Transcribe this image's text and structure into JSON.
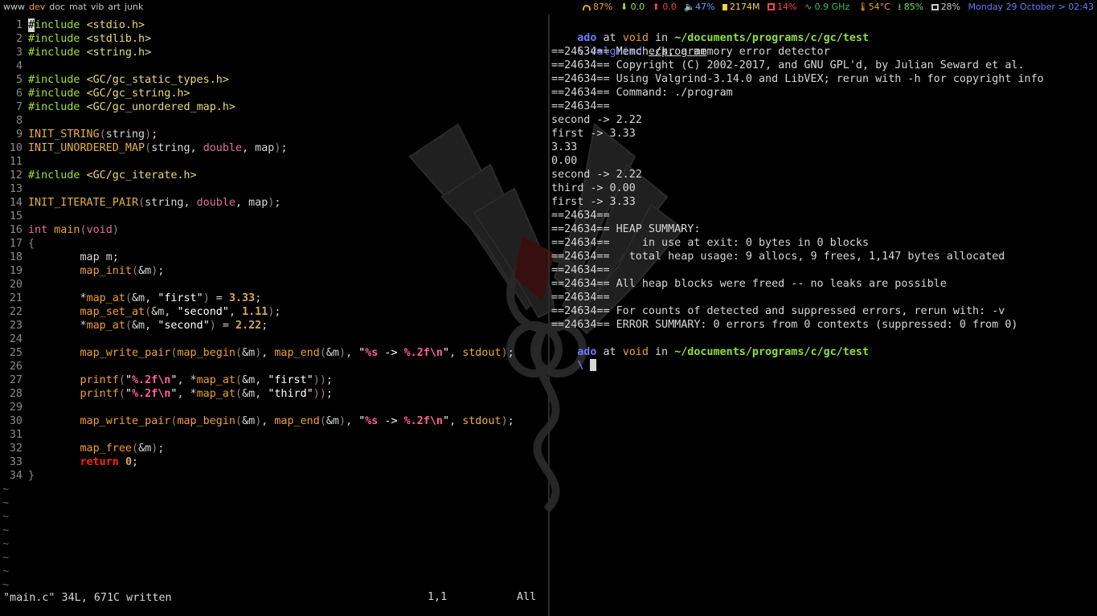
{
  "topbar": {
    "tags": [
      "www",
      "dev",
      "doc",
      "mat",
      "vib",
      "art",
      "junk"
    ],
    "active_tag": "dev",
    "wifi": "87%",
    "net_down": "0.0",
    "net_up": "0.0",
    "volume": "47%",
    "memory": "2174M",
    "cpu": "14%",
    "cpu_freq": "0.9 GHz",
    "temp": "54°C",
    "battery": "85%",
    "disk": "28%",
    "datetime": "Monday 29 October > 02:43",
    "colors": {
      "wifi": "#f0a030",
      "down": "#a6e22e",
      "up": "#ff4040",
      "vol": "#6a9bff",
      "mem": "#ffd040",
      "cpu": "#ff4060",
      "freq": "#40c060",
      "temp": "#f0a030",
      "battery": "#60e060",
      "disk": "#c8c8c8",
      "date": "#6a7bff"
    }
  },
  "editor": {
    "lines": [
      "#include <stdio.h>",
      "#include <stdlib.h>",
      "#include <string.h>",
      "",
      "#include <GC/gc_static_types.h>",
      "#include <GC/gc_string.h>",
      "#include <GC/gc_unordered_map.h>",
      "",
      "INIT_STRING(string);",
      "INIT_UNORDERED_MAP(string, double, map);",
      "",
      "#include <GC/gc_iterate.h>",
      "",
      "INIT_ITERATE_PAIR(string, double, map);",
      "",
      "int main(void)",
      "{",
      "        map m;",
      "        map_init(&m);",
      "",
      "        *map_at(&m, \"first\") = 3.33;",
      "        map_set_at(&m, \"second\", 1.11);",
      "        *map_at(&m, \"second\") = 2.22;",
      "",
      "        map_write_pair(map_begin(&m), map_end(&m), \"%s -> %.2f\\n\", stdout);",
      "",
      "        printf(\"%.2f\\n\", *map_at(&m, \"first\"));",
      "        printf(\"%.2f\\n\", *map_at(&m, \"third\"));",
      "",
      "        map_write_pair(map_begin(&m), map_end(&m), \"%s -> %.2f\\n\", stdout);",
      "",
      "        map_free(&m);",
      "        return 0;",
      "}"
    ],
    "tilde_count": 8,
    "status_message": "\"main.c\" 34L, 671C written",
    "cursor_pos": "1,1",
    "scroll": "All"
  },
  "terminal": {
    "prompt": {
      "user": "ado",
      "at": "at",
      "host": "void",
      "in": "in",
      "path": "~/documents/programs/c/gc/test",
      "arrow": "\\"
    },
    "command": "valgrind",
    "command_arg": "./program",
    "output": [
      "==24634== Memcheck, a memory error detector",
      "==24634== Copyright (C) 2002-2017, and GNU GPL'd, by Julian Seward et al.",
      "==24634== Using Valgrind-3.14.0 and LibVEX; rerun with -h for copyright info",
      "==24634== Command: ./program",
      "==24634==",
      "second -> 2.22",
      "first -> 3.33",
      "3.33",
      "0.00",
      "second -> 2.22",
      "third -> 0.00",
      "first -> 3.33",
      "==24634==",
      "==24634== HEAP SUMMARY:",
      "==24634==     in use at exit: 0 bytes in 0 blocks",
      "==24634==   total heap usage: 9 allocs, 9 frees, 1,147 bytes allocated",
      "==24634==",
      "==24634== All heap blocks were freed -- no leaks are possible",
      "==24634==",
      "==24634== For counts of detected and suppressed errors, rerun with: -v",
      "==24634== ERROR SUMMARY: 0 errors from 0 contexts (suppressed: 0 from 0)"
    ]
  }
}
